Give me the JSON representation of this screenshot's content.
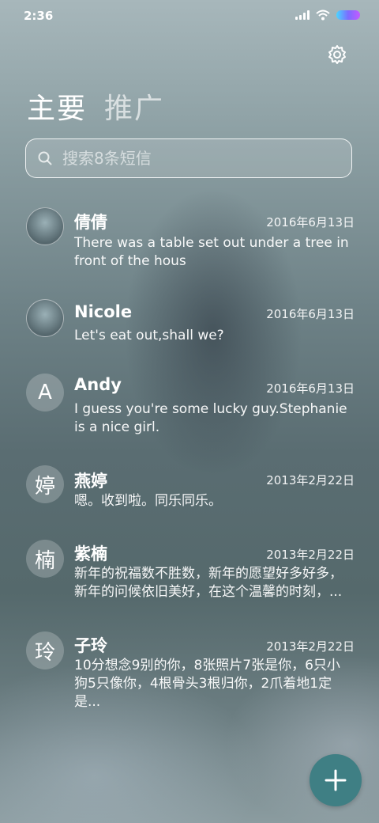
{
  "status": {
    "time": "2:36"
  },
  "tabs": {
    "primary": "主要",
    "promo": "推广"
  },
  "search": {
    "placeholder": "搜索8条短信"
  },
  "messages": [
    {
      "name": "倩倩",
      "date": "2016年6月13日",
      "preview": "There was a table set out under a tree in front of the hous",
      "avatar": "photo"
    },
    {
      "name": "Nicole",
      "date": "2016年6月13日",
      "preview": "Let's eat out,shall we?",
      "avatar": "photo"
    },
    {
      "name": "Andy",
      "date": "2016年6月13日",
      "preview": "I guess you're some lucky guy.Stephanie is a nice girl.",
      "avatar": "A"
    },
    {
      "name": "燕婷",
      "date": "2013年2月22日",
      "preview": "嗯。收到啦。同乐同乐。",
      "avatar": "婷"
    },
    {
      "name": "紫楠",
      "date": "2013年2月22日",
      "preview": "新年的祝福数不胜数，新年的愿望好多好多，新年的问候依旧美好，在这个温馨的时刻，...",
      "avatar": "楠"
    },
    {
      "name": "子玲",
      "date": "2013年2月22日",
      "preview": "10分想念9别的你，8张照片7张是你，6只小狗5只像你，4根骨头3根归你，2爪着地1定是...",
      "avatar": "玲"
    }
  ],
  "icons": {
    "settings": "gear-icon",
    "search": "search-icon",
    "compose": "plus-icon"
  }
}
